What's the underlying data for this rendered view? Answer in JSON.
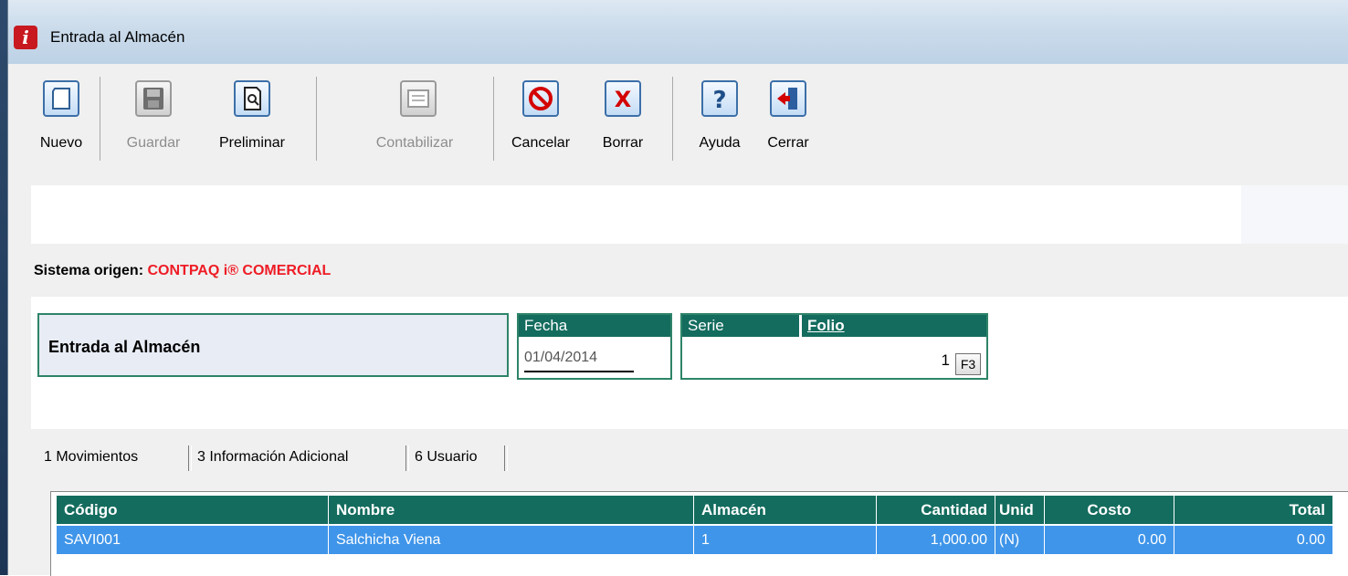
{
  "window": {
    "title": "Entrada al Almacén",
    "app_icon_letter": "i"
  },
  "toolbar": {
    "nuevo": "Nuevo",
    "guardar": "Guardar",
    "preliminar": "Preliminar",
    "contabilizar": "Contabilizar",
    "cancelar": "Cancelar",
    "borrar": "Borrar",
    "ayuda": "Ayuda",
    "cerrar": "Cerrar"
  },
  "origin": {
    "label": "Sistema origen:",
    "value": "CONTPAQ i® COMERCIAL"
  },
  "document": {
    "title": "Entrada al Almacén",
    "fecha_label": "Fecha",
    "fecha_value": "01/04/2014",
    "serie_label": "Serie",
    "folio_label": "Folio",
    "folio_value": "1",
    "f3_label": "F3"
  },
  "tabs": [
    {
      "label": "1 Movimientos"
    },
    {
      "label": "3 Información Adicional"
    },
    {
      "label": "6 Usuario"
    }
  ],
  "table": {
    "columns": [
      "Código",
      "Nombre",
      "Almacén",
      "Cantidad",
      "Unid",
      "Costo",
      "Total"
    ],
    "rows": [
      [
        "SAVI001",
        "Salchicha Viena",
        "1",
        "1,000.00",
        "(N)",
        "0.00",
        "0.00"
      ]
    ]
  },
  "colors": {
    "header_green": "#146c5e",
    "border_green": "#2e8468",
    "selection_blue": "#3f95e9",
    "origin_red": "#ee1c25"
  },
  "icons": [
    "new-doc-icon",
    "save-disk-icon",
    "preview-icon",
    "accounting-icon",
    "cancel-icon",
    "delete-x-icon",
    "help-icon",
    "close-door-icon"
  ]
}
